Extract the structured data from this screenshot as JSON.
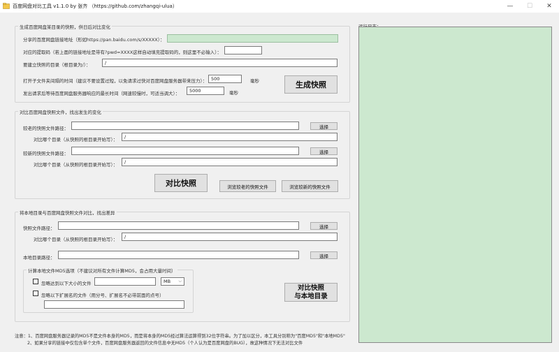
{
  "window": {
    "title": "百度网盘对比工具 v1.1.0 by 张齐 （https://github.com/zhangqi-ulua）",
    "minimize": "—",
    "maximize": "☐",
    "close": "✕"
  },
  "snapshot_group": {
    "title": "生成百度网盘某目录的快照，供日后对比变化",
    "share_link_label": "分享的百度网盘链接地址（形如https://pan.baidu.com/s/XXXXX）：",
    "share_link_value": "",
    "code_label": "对应的提取码（若上面的链接地址是带有?pwd=XXXX这样自动填充提取码的，则这里不必输入）：",
    "code_value": "",
    "dir_label": "要建立快照的目录（根目录为/）：",
    "dir_value": "/",
    "interval_label": "打开子文件夹间隔的时间（建议不要设置过短，以免请求过快对百度网盘服务器带来压力）：",
    "interval_value": "500",
    "interval_unit": "毫秒",
    "timeout_label": "发出请求后等待百度网盘服务器响应的最长时间（网速较慢时，可适当调大）：",
    "timeout_value": "5000",
    "timeout_unit": "毫秒",
    "generate_button": "生成快照"
  },
  "compare_group": {
    "title": "对比百度网盘快照文件，找出发生的变化",
    "old_path_label": "较老的快照文件路径：",
    "old_path_value": "",
    "old_choose": "选择",
    "old_dir_label": "对比哪个目录（从快照的根目录开始写）：",
    "old_dir_value": "/",
    "new_path_label": "较新的快照文件路径：",
    "new_path_value": "",
    "new_choose": "选择",
    "new_dir_label": "对比哪个目录（从快照的根目录开始写）：",
    "new_dir_value": "/",
    "compare_button": "对比快照",
    "browse_old": "浏览较老的快照文件",
    "browse_new": "浏览较新的快照文件"
  },
  "local_group": {
    "title": "将本地目录与百度网盘快照文件对比，找出差异",
    "snap_path_label": "快照文件路径：",
    "snap_path_value": "",
    "snap_choose": "选择",
    "snap_dir_label": "对比哪个目录（从快照的根目录开始写）：",
    "snap_dir_value": "/",
    "local_dir_label": "本地目录路径：",
    "local_dir_value": "",
    "local_choose": "选择",
    "md5_group_title": "计算本地文件MD5选项（不建议对所有文件计算MD5，会占用大量时间）",
    "ignore_size_label": "忽略达到以下大小的文件",
    "ignore_size_value": "",
    "unit_value": "MB",
    "ignore_ext_label": "忽略以下扩展名的文件（用分号、扩展名不必带前面的点号）",
    "ignore_ext_value": "",
    "compare_local_line1": "对比快照",
    "compare_local_line2": "与本地目录"
  },
  "log": {
    "label": "运行日志："
  },
  "notes": {
    "line1": "注意：1、百度网盘服务器记录的MD5不是文件本身的MD5，而是将本身的MD5经过算法运算得到32位字符串。为了加以区分，本工具分别称为\"百度MD5\"和\"本地MD5\"",
    "line2": "2、如果分享的链接中仅包含单个文件，百度网盘服务器返回的文件信息中无MD5（个人认为是百度网盘的BUG），故这种情况下无法对比文件"
  }
}
